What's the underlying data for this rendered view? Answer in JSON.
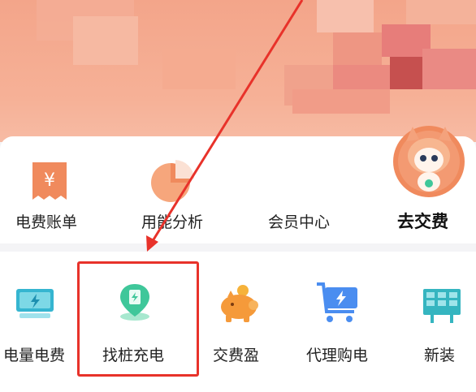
{
  "top_services": [
    {
      "label": "电费账单",
      "icon": "bill-yen-icon"
    },
    {
      "label": "用能分析",
      "icon": "pie-chart-icon"
    },
    {
      "label": "会员中心",
      "icon": "member-icon"
    },
    {
      "label": "去交费",
      "icon": "mascot-avatar"
    }
  ],
  "bottom_services": [
    {
      "label": "电量电费",
      "icon": "battery-bolt-icon"
    },
    {
      "label": "找桩充电",
      "icon": "charging-pile-location-icon"
    },
    {
      "label": "交费盈",
      "icon": "piggy-bank-icon"
    },
    {
      "label": "代理购电",
      "icon": "cart-bolt-icon"
    },
    {
      "label": "新装",
      "icon": "solar-panel-icon"
    }
  ],
  "colors": {
    "banner": "#f3a58a",
    "accent_orange": "#f08a5d",
    "highlight_red": "#e8322a",
    "green": "#3fc79a",
    "blue": "#4a8df0",
    "teal": "#35b5d0"
  }
}
